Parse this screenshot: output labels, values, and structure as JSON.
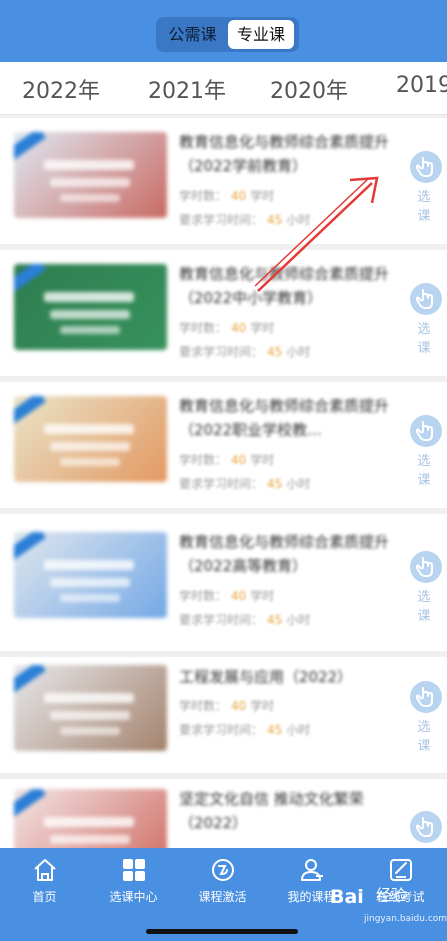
{
  "header": {
    "tabs": [
      {
        "label": "公需课",
        "active": false
      },
      {
        "label": "专业课",
        "active": true
      }
    ]
  },
  "years": [
    "2022年",
    "2021年",
    "2020年",
    "2019"
  ],
  "select_label": "选 课",
  "courses": [
    {
      "title": "教育信息化与教师综合素质提升（2022学前教育）",
      "hours_label": "学时数：",
      "hours": "40",
      "hours_unit": "学时",
      "req_label": "要求学习时间：",
      "req": "45",
      "req_unit": "小时",
      "thumb_bg": "#dfe8f2",
      "thumb_accent": "#c0392b"
    },
    {
      "title": "教育信息化与教师综合素质提升（2022中小学教育）",
      "hours_label": "学时数：",
      "hours": "40",
      "hours_unit": "学时",
      "req_label": "要求学习时间：",
      "req": "45",
      "req_unit": "小时",
      "thumb_bg": "#2e7d4f",
      "thumb_accent": "#3a9a62"
    },
    {
      "title": "教育信息化与教师综合素质提升（2022职业学校教...",
      "hours_label": "学时数：",
      "hours": "40",
      "hours_unit": "学时",
      "req_label": "要求学习时间：",
      "req": "45",
      "req_unit": "小时",
      "thumb_bg": "#e9e4c8",
      "thumb_accent": "#e07a3a"
    },
    {
      "title": "教育信息化与教师综合素质提升（2022高等教育）",
      "hours_label": "学时数：",
      "hours": "40",
      "hours_unit": "学时",
      "req_label": "要求学习时间：",
      "req": "45",
      "req_unit": "小时",
      "thumb_bg": "#dfe6ee",
      "thumb_accent": "#4a90e2"
    },
    {
      "title": "工程发展与应用（2022）",
      "hours_label": "学时数：",
      "hours": "40",
      "hours_unit": "学时",
      "req_label": "要求学习时间：",
      "req": "45",
      "req_unit": "小时",
      "thumb_bg": "#e6e8ec",
      "thumb_accent": "#8a5a3a"
    },
    {
      "title": "坚定文化自信 推动文化繁荣（2022）",
      "hours_label": "",
      "hours": "",
      "hours_unit": "",
      "req_label": "",
      "req": "",
      "req_unit": "",
      "thumb_bg": "#f3e6e6",
      "thumb_accent": "#c0392b"
    }
  ],
  "tabbar": {
    "items": [
      {
        "label": "首页",
        "icon": "home-icon"
      },
      {
        "label": "选课中心",
        "icon": "grid-icon"
      },
      {
        "label": "课程激活",
        "icon": "activate-icon"
      },
      {
        "label": "我的课程",
        "icon": "user-icon"
      },
      {
        "label": "在线考试",
        "icon": "exam-icon"
      }
    ]
  },
  "watermark": {
    "brand": "Bai",
    "brand2": "经验",
    "url": "jingyan.baidu.com"
  },
  "colors": {
    "primary": "#4a90e2",
    "accent_number": "#e8a33a",
    "arrow": "#e53935"
  }
}
